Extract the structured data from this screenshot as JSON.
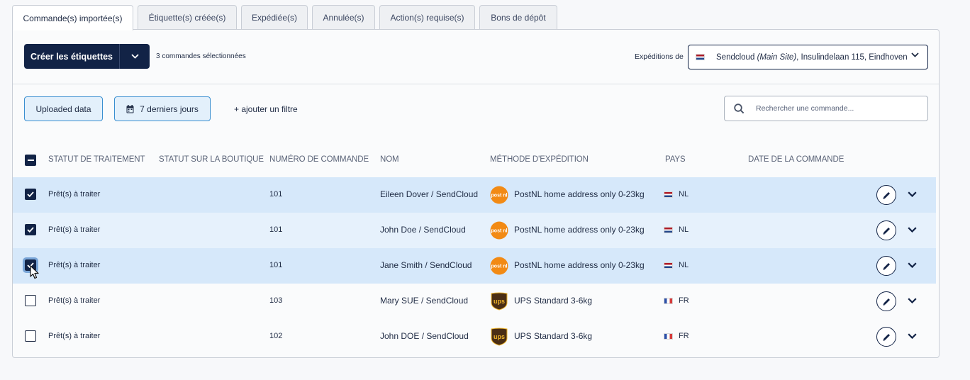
{
  "tabs": [
    {
      "label": "Commande(s) importée(s)",
      "active": true
    },
    {
      "label": "Étiquette(s) créée(s)",
      "active": false
    },
    {
      "label": "Expédiée(s)",
      "active": false
    },
    {
      "label": "Annulée(s)",
      "active": false
    },
    {
      "label": "Action(s) requise(s)",
      "active": false
    },
    {
      "label": "Bons de dépôt",
      "active": false
    }
  ],
  "toolbar": {
    "create_label": "Créer les étiquettes",
    "selected_count": "3 commandes sélectionnées",
    "shipments_from_label": "Expéditions de",
    "sender_name": "Sendcloud",
    "sender_site": "(Main Site)",
    "sender_address": ", Insulindelaan 115, Eindhoven"
  },
  "filters": {
    "uploaded_label": "Uploaded data",
    "days_label": "7 derniers jours",
    "add_filter_label": "+ ajouter un filtre",
    "search_placeholder": "Rechercher une commande..."
  },
  "columns": {
    "status": "STATUT DE TRAITEMENT",
    "shop_status": "STATUT SUR LA BOUTIQUE",
    "order_number": "NUMÉRO DE COMMANDE",
    "name": "NOM",
    "shipping_method": "MÉTHODE D'EXPÉDITION",
    "country": "PAYS",
    "order_date": "DATE DE LA COMMANDE"
  },
  "rows": [
    {
      "checked": true,
      "status": "Prêt(s) à traiter",
      "order": "101",
      "name": "Eileen Dover / SendCloud",
      "carrier": "postnl",
      "method": "PostNL home address only 0-23kg",
      "country": "NL"
    },
    {
      "checked": true,
      "status": "Prêt(s) à traiter",
      "order": "101",
      "name": "John Doe / SendCloud",
      "carrier": "postnl",
      "method": "PostNL home address only 0-23kg",
      "country": "NL"
    },
    {
      "checked": true,
      "status": "Prêt(s) à traiter",
      "order": "101",
      "name": "Jane Smith / SendCloud",
      "carrier": "postnl",
      "method": "PostNL home address only 0-23kg",
      "country": "NL"
    },
    {
      "checked": false,
      "status": "Prêt(s) à traiter",
      "order": "103",
      "name": "Mary SUE / SendCloud",
      "carrier": "ups",
      "method": "UPS Standard 3-6kg",
      "country": "FR"
    },
    {
      "checked": false,
      "status": "Prêt(s) à traiter",
      "order": "102",
      "name": "John DOE / SendCloud",
      "carrier": "ups",
      "method": "UPS Standard 3-6kg",
      "country": "FR"
    }
  ],
  "carrier_logo_text": {
    "postnl": "post nl",
    "ups": "ups"
  },
  "colors": {
    "primary": "#122346",
    "selected_row": "#d6e8fa",
    "accent": "#3a8fd0",
    "postnl": "#f28a14",
    "ups": "#5a3a1a"
  }
}
